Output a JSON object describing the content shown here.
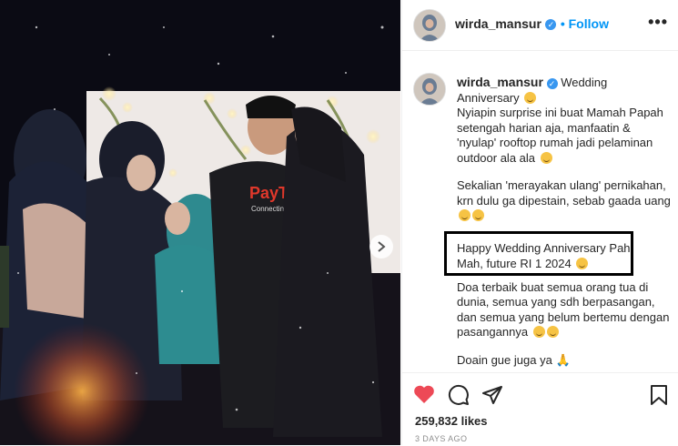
{
  "post": {
    "username": "wirda_mansur",
    "verified_badge": "✓",
    "follow_label": "• Follow",
    "more_label": "•••"
  },
  "caption": {
    "username": "wirda_mansur",
    "title": "Wedding Anniversary",
    "para1": "Nyiapin surprise ini buat Mamah Papah setengah harian aja, manfaatin & 'nyulap' rooftop rumah jadi pelaminan outdoor ala ala",
    "para2": "Sekalian 'merayakan ulang' pernikahan, krn dulu ga dipestain, sebab gaada uang",
    "highlight": "Happy Wedding Anniversary Pah, Mah, future RI 1 2024",
    "para3": "Doa terbaik buat semua orang tua di dunia, semua yang sdh berpasangan, dan semua yang belum bertemu dengan pasangannya",
    "para4": "Doain gue juga ya"
  },
  "photo": {
    "shirt_text": "PayTre",
    "shirt_subtext": "Connecting"
  },
  "stats": {
    "likes": "259,832 likes",
    "time": "3 DAYS AGO"
  },
  "colors": {
    "accent": "#0095f6",
    "heart": "#ed4956",
    "text": "#262626"
  },
  "icons": [
    "heart-icon",
    "comment-icon",
    "share-icon",
    "bookmark-icon",
    "next-arrow-icon",
    "verified-icon",
    "more-options-icon"
  ]
}
